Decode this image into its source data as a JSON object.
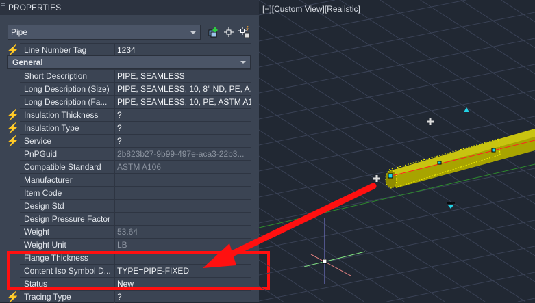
{
  "panel": {
    "title": "PROPERTIES",
    "object_type": "Pipe",
    "toolbar": {
      "add_selected": "add-to-selection-icon",
      "select_objects": "select-objects-icon",
      "quick_select": "quick-select-icon"
    }
  },
  "line_number": {
    "name": "Line Number Tag",
    "value": "1234"
  },
  "section": {
    "title": "General"
  },
  "properties": [
    {
      "name": "Short Description",
      "value": "PIPE, SEAMLESS",
      "bolt": false,
      "ro": false
    },
    {
      "name": "Long Description (Size)",
      "value": "PIPE, SEAMLESS, 10, 8\" ND, PE, A...",
      "bolt": false,
      "ro": false
    },
    {
      "name": "Long Description (Fa...",
      "value": "PIPE, SEAMLESS, 10, PE, ASTM A1...",
      "bolt": false,
      "ro": false
    },
    {
      "name": "Insulation Thickness",
      "value": "?",
      "bolt": true,
      "ro": false
    },
    {
      "name": "Insulation Type",
      "value": "?",
      "bolt": true,
      "ro": false
    },
    {
      "name": "Service",
      "value": "?",
      "bolt": true,
      "ro": false
    },
    {
      "name": "PnPGuid",
      "value": "2b823b27-9b99-497e-aca3-22b3...",
      "bolt": false,
      "ro": true
    },
    {
      "name": "Compatible Standard",
      "value": "ASTM A106",
      "bolt": false,
      "ro": true
    },
    {
      "name": "Manufacturer",
      "value": "",
      "bolt": false,
      "ro": false
    },
    {
      "name": "Item Code",
      "value": "",
      "bolt": false,
      "ro": false
    },
    {
      "name": "Design Std",
      "value": "",
      "bolt": false,
      "ro": false
    },
    {
      "name": "Design Pressure Factor",
      "value": "",
      "bolt": false,
      "ro": false
    },
    {
      "name": "Weight",
      "value": "53.64",
      "bolt": false,
      "ro": true
    },
    {
      "name": "Weight Unit",
      "value": "LB",
      "bolt": false,
      "ro": true
    },
    {
      "name": "Flange Thickness",
      "value": "",
      "bolt": false,
      "ro": false
    },
    {
      "name": "Content Iso Symbol D...",
      "value": "TYPE=PIPE-FIXED",
      "bolt": false,
      "ro": false
    },
    {
      "name": "Status",
      "value": "New",
      "bolt": false,
      "ro": false
    },
    {
      "name": "Tracing Type",
      "value": "?",
      "bolt": true,
      "ro": false
    }
  ],
  "viewport": {
    "label": "[−][Custom View][Realistic]"
  },
  "colors": {
    "highlight": "#ff1010",
    "pipe": "#b5b000",
    "grip": "#22d3e6"
  }
}
